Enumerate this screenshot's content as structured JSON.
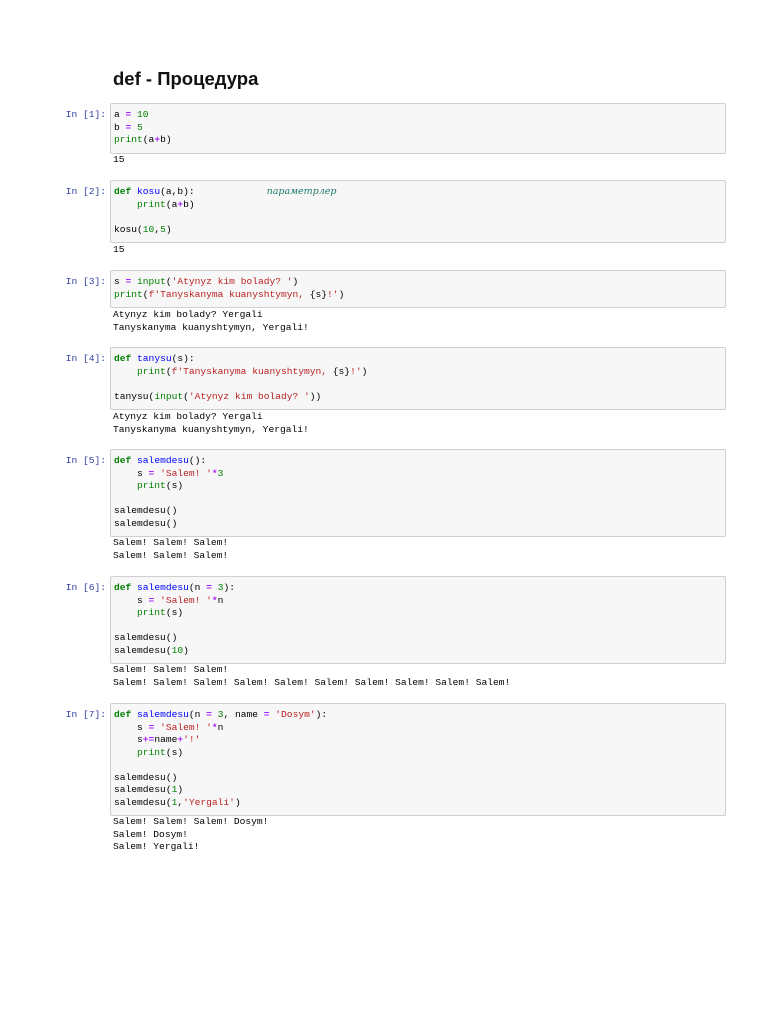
{
  "title": "def - Процедура",
  "cells": [
    {
      "prompt": "In [1]:",
      "input": [
        [
          [
            "a ",
            ""
          ],
          [
            "=",
            "op"
          ],
          [
            " ",
            ""
          ],
          [
            "10",
            "num"
          ]
        ],
        [
          [
            "b ",
            ""
          ],
          [
            "=",
            "op"
          ],
          [
            " ",
            ""
          ],
          [
            "5",
            "num"
          ]
        ],
        [
          [
            "print",
            "bi"
          ],
          [
            "(a",
            ""
          ],
          [
            "+",
            "op"
          ],
          [
            "b)",
            ""
          ]
        ]
      ],
      "output": [
        "15"
      ]
    },
    {
      "prompt": "In [2]:",
      "input": [
        [
          [
            "def",
            "k"
          ],
          [
            " ",
            ""
          ],
          [
            "kosu",
            "fn"
          ],
          [
            "(a,b):",
            ""
          ],
          [
            "",
            "sp"
          ],
          [
            "параметрлер",
            "it"
          ]
        ],
        [
          [
            "    ",
            ""
          ],
          [
            "print",
            "bi"
          ],
          [
            "(a",
            ""
          ],
          [
            "+",
            "op"
          ],
          [
            "b)",
            ""
          ]
        ],
        [],
        [
          [
            "kosu(",
            ""
          ],
          [
            "10",
            "num"
          ],
          [
            ",",
            ""
          ],
          [
            "5",
            "num"
          ],
          [
            ")",
            ""
          ]
        ]
      ],
      "output": [
        "15"
      ]
    },
    {
      "prompt": "In [3]:",
      "input": [
        [
          [
            "s ",
            ""
          ],
          [
            "=",
            "op"
          ],
          [
            " ",
            ""
          ],
          [
            "input",
            "bi"
          ],
          [
            "(",
            ""
          ],
          [
            "'Atynyz kim bolady? '",
            "str"
          ],
          [
            ")",
            ""
          ]
        ],
        [
          [
            "print",
            "bi"
          ],
          [
            "(",
            ""
          ],
          [
            "f'Tanyskanyma kuanyshtymyn, ",
            "str"
          ],
          [
            "{s}",
            ""
          ],
          [
            "!'",
            "str"
          ],
          [
            ")",
            ""
          ]
        ]
      ],
      "output": [
        "Atynyz kim bolady? Yergali",
        "Tanyskanyma kuanyshtymyn, Yergali!"
      ]
    },
    {
      "prompt": "In [4]:",
      "input": [
        [
          [
            "def",
            "k"
          ],
          [
            " ",
            ""
          ],
          [
            "tanysu",
            "fn"
          ],
          [
            "(s):",
            ""
          ]
        ],
        [
          [
            "    ",
            ""
          ],
          [
            "print",
            "bi"
          ],
          [
            "(",
            ""
          ],
          [
            "f'Tanyskanyma kuanyshtymyn, ",
            "str"
          ],
          [
            "{s}",
            ""
          ],
          [
            "!'",
            "str"
          ],
          [
            ")",
            ""
          ]
        ],
        [],
        [
          [
            "tanysu(",
            ""
          ],
          [
            "input",
            "bi"
          ],
          [
            "(",
            ""
          ],
          [
            "'Atynyz kim bolady? '",
            "str"
          ],
          [
            "))",
            ""
          ]
        ]
      ],
      "output": [
        "Atynyz kim bolady? Yergali",
        "Tanyskanyma kuanyshtymyn, Yergali!"
      ]
    },
    {
      "prompt": "In [5]:",
      "input": [
        [
          [
            "def",
            "k"
          ],
          [
            " ",
            ""
          ],
          [
            "salemdesu",
            "fn"
          ],
          [
            "():",
            ""
          ]
        ],
        [
          [
            "    s ",
            ""
          ],
          [
            "=",
            "op"
          ],
          [
            " ",
            ""
          ],
          [
            "'Salem! '",
            "str"
          ],
          [
            "*",
            "op"
          ],
          [
            "3",
            "num"
          ]
        ],
        [
          [
            "    ",
            ""
          ],
          [
            "print",
            "bi"
          ],
          [
            "(s)",
            ""
          ]
        ],
        [],
        [
          [
            "salemdesu()",
            ""
          ]
        ],
        [
          [
            "salemdesu()",
            ""
          ]
        ]
      ],
      "output": [
        "Salem! Salem! Salem!",
        "Salem! Salem! Salem!"
      ]
    },
    {
      "prompt": "In [6]:",
      "input": [
        [
          [
            "def",
            "k"
          ],
          [
            " ",
            ""
          ],
          [
            "salemdesu",
            "fn"
          ],
          [
            "(n ",
            ""
          ],
          [
            "=",
            "op"
          ],
          [
            " ",
            ""
          ],
          [
            "3",
            "num"
          ],
          [
            "):",
            ""
          ]
        ],
        [
          [
            "    s ",
            ""
          ],
          [
            "=",
            "op"
          ],
          [
            " ",
            ""
          ],
          [
            "'Salem! '",
            "str"
          ],
          [
            "*",
            "op"
          ],
          [
            "n",
            ""
          ]
        ],
        [
          [
            "    ",
            ""
          ],
          [
            "print",
            "bi"
          ],
          [
            "(s)",
            ""
          ]
        ],
        [],
        [
          [
            "salemdesu()",
            ""
          ]
        ],
        [
          [
            "salemdesu(",
            ""
          ],
          [
            "10",
            "num"
          ],
          [
            ")",
            ""
          ]
        ]
      ],
      "output": [
        "Salem! Salem! Salem!",
        "Salem! Salem! Salem! Salem! Salem! Salem! Salem! Salem! Salem! Salem!"
      ]
    },
    {
      "prompt": "In [7]:",
      "input": [
        [
          [
            "def",
            "k"
          ],
          [
            " ",
            ""
          ],
          [
            "salemdesu",
            "fn"
          ],
          [
            "(n ",
            ""
          ],
          [
            "=",
            "op"
          ],
          [
            " ",
            ""
          ],
          [
            "3",
            "num"
          ],
          [
            ", name ",
            ""
          ],
          [
            "=",
            "op"
          ],
          [
            " ",
            ""
          ],
          [
            "'Dosym'",
            "str"
          ],
          [
            "):",
            ""
          ]
        ],
        [
          [
            "    s ",
            ""
          ],
          [
            "=",
            "op"
          ],
          [
            " ",
            ""
          ],
          [
            "'Salem! '",
            "str"
          ],
          [
            "*",
            "op"
          ],
          [
            "n",
            ""
          ]
        ],
        [
          [
            "    s",
            ""
          ],
          [
            "+=",
            "op"
          ],
          [
            "name",
            ""
          ],
          [
            "+",
            "op"
          ],
          [
            "'!'",
            "str"
          ]
        ],
        [
          [
            "    ",
            ""
          ],
          [
            "print",
            "bi"
          ],
          [
            "(s)",
            ""
          ]
        ],
        [],
        [
          [
            "salemdesu()",
            ""
          ]
        ],
        [
          [
            "salemdesu(",
            ""
          ],
          [
            "1",
            "num"
          ],
          [
            ")",
            ""
          ]
        ],
        [
          [
            "salemdesu(",
            ""
          ],
          [
            "1",
            "num"
          ],
          [
            ",",
            ""
          ],
          [
            "'Yergali'",
            "str"
          ],
          [
            ")",
            ""
          ]
        ]
      ],
      "output": [
        "Salem! Salem! Salem! Dosym!",
        "Salem! Dosym!",
        "Salem! Yergali!"
      ]
    }
  ]
}
